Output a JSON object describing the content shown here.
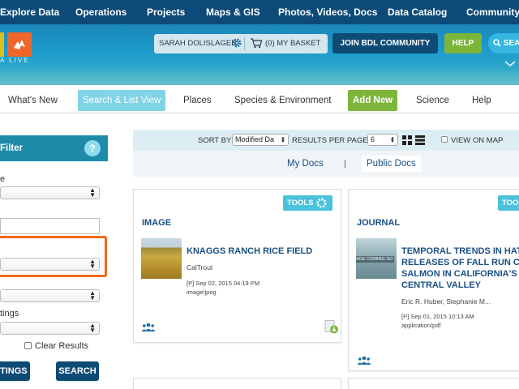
{
  "topnav": {
    "items": [
      "Explore Data",
      "Operations",
      "Projects",
      "Maps & GIS",
      "Photos, Videos, Docs",
      "Data Catalog",
      "Community"
    ]
  },
  "banner": {
    "logo_text": "A LIVE",
    "user_name": "SARAH DOLISLAGER",
    "basket_label": "(0) MY BASKET",
    "join_label": "JOIN BDL COMMUNITY",
    "help_label": "HELP",
    "search_label": "SEAR"
  },
  "subnav": {
    "tabs": [
      "What's New",
      "Search & List View",
      "Places",
      "Species & Environment",
      "Add New",
      "Science",
      "Help"
    ]
  },
  "filter": {
    "title": "Filter",
    "help_glyph": "?",
    "label_type": "e",
    "label_settings": "tings",
    "clear_label": "Clear Results",
    "settings_button": "TINGS",
    "search_button": "SEARCH"
  },
  "sortbar": {
    "sort_by_label": "SORT BY",
    "sort_value": "Modified Da",
    "results_label": "RESULTS PER PAGE",
    "results_value": "6",
    "view_on_map_label": "VIEW ON MAP"
  },
  "doctabs": {
    "my_docs": "My Docs",
    "separator": "|",
    "public_docs": "Public Docs"
  },
  "cards": [
    {
      "tools_label": "TOOLS",
      "type": "IMAGE",
      "title": "KNAGGS RANCH RICE FIELD",
      "author": "CalTrout",
      "date": "[P] Sep 02, 2015 04:19 PM",
      "mime": "image/jpeg"
    },
    {
      "tools_label": "TOOLS",
      "type": "JOURNAL",
      "title_lines": [
        "TEMPORAL TRENDS IN HAT",
        "RELEASES OF FALL RUN CHI",
        "SALMON IN CALIFORNIA'S",
        "CENTRAL VALLEY"
      ],
      "thumb_text": "AGE COMING SO",
      "author": "Eric R. Huber, Stephanie M...",
      "date": "[P] Sep 01, 2015 10:13 AM",
      "mime": "application/pdf"
    },
    {
      "tools_label": "TOOL"
    }
  ],
  "colors": {
    "topnav": "#0d4a78",
    "accent_teal": "#1e8ba8",
    "green": "#7cb53a",
    "orange_highlight": "#f0691c"
  }
}
